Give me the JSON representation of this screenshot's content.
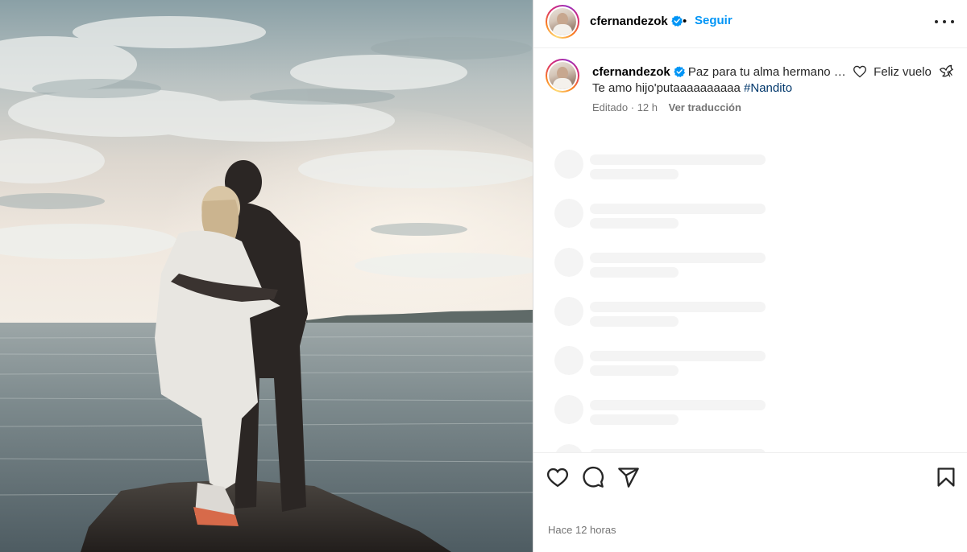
{
  "post": {
    "username": "cfernandezok",
    "verified": true,
    "follow_label": "Seguir",
    "separator": "•"
  },
  "caption": {
    "username": "cfernandezok",
    "text_part1": "Paz para tu alma hermano …",
    "text_part2": "Feliz vuelo",
    "text_line2": "Te amo hijo'putaaaaaaaaaa",
    "hashtag": "#Nandito",
    "edited_label": "Editado",
    "meta_separator": "·",
    "time": "12 h",
    "translate_label": "Ver traducción"
  },
  "icons": {
    "more": "more-options-icon",
    "like": "heart-icon",
    "comment": "comment-bubble-icon",
    "share": "paper-plane-icon",
    "save": "bookmark-icon",
    "verified": "verified-badge-icon"
  },
  "footer": {
    "time_ago": "Hace 12 horas"
  },
  "colors": {
    "accent": "#0095f6",
    "verified_blue": "#0095f6",
    "hashtag": "#00376b",
    "secondary_text": "#737373",
    "skeleton": "#f4f4f4"
  }
}
